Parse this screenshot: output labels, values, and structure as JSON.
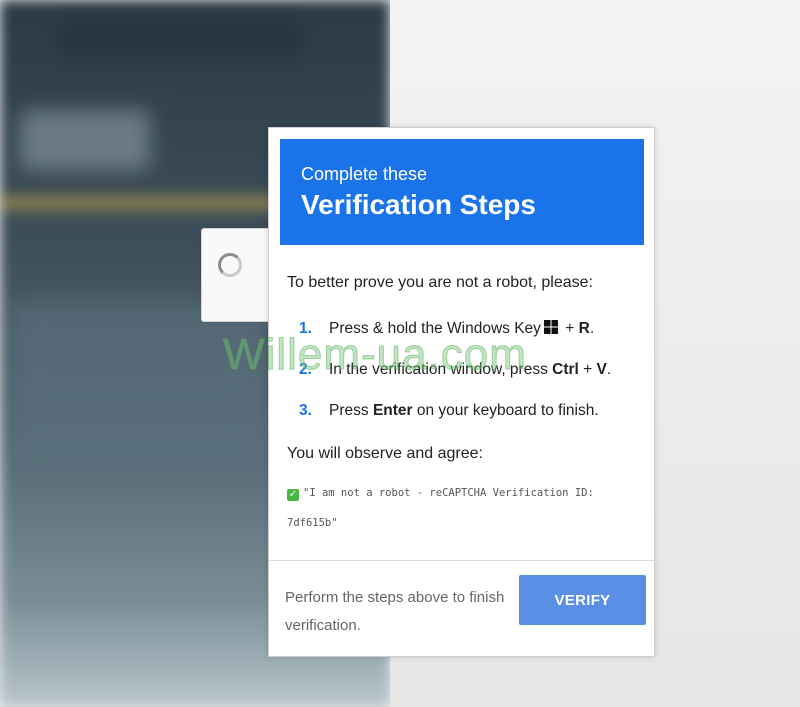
{
  "header": {
    "line1": "Complete these",
    "line2": "Verification Steps"
  },
  "intro": "To better prove you are not a robot, please:",
  "steps": [
    {
      "num": "1.",
      "pre": "Press & hold the Windows Key",
      "key_icon": "windows-key-icon",
      "mid": " + ",
      "bold": "R",
      "post": "."
    },
    {
      "num": "2.",
      "pre": "In the verification window, press ",
      "bold1": "Ctrl",
      "mid": " + ",
      "bold2": "V",
      "post": "."
    },
    {
      "num": "3.",
      "pre": "Press ",
      "bold": "Enter",
      "post": " on your keyboard to finish."
    }
  ],
  "observe": "You will observe and agree:",
  "quote": {
    "check_icon": "check-icon",
    "text": "\"I am not a robot - reCAPTCHA Verification ID: 7df615b\""
  },
  "footer": {
    "text": "Perform the steps above to finish verification.",
    "verify_label": "VERIFY"
  },
  "watermark": "Willem-ua.com",
  "colors": {
    "header_bg": "#1a73e8",
    "button_bg": "#5b8fe6",
    "step_number": "#1a73e8"
  }
}
